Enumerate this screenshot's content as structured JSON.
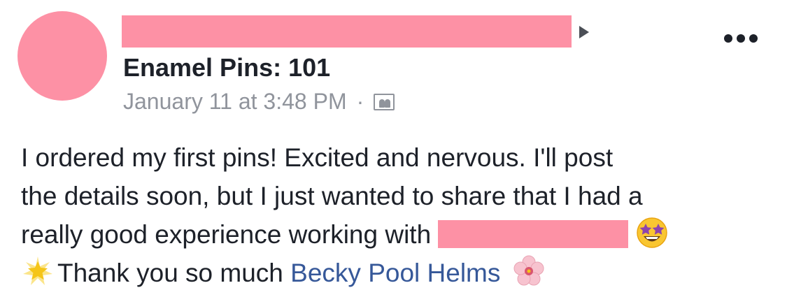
{
  "post": {
    "group_name": "Enamel Pins: 101",
    "timestamp": "January 11 at 3:48 PM",
    "separator": "·",
    "privacy_icon": "members-icon",
    "body_lines": [
      "I ordered my first pins! Excited and nervous. I'll post",
      "the details soon, but I just wanted to share that I had a",
      "really good experience working with"
    ],
    "thanks_text": "Thank you so much",
    "mention": "Becky Pool Helms",
    "icons": {
      "star_struck": "star-struck-emoji",
      "glowing_star": "glowing-star-emoji",
      "cherry_blossom": "cherry-blossom-emoji",
      "arrow": "right-arrow-icon",
      "more": "more-options-icon"
    }
  },
  "colors": {
    "redaction": "#fd91a5",
    "text": "#1d2129",
    "muted": "#90949c",
    "link": "#365899"
  }
}
